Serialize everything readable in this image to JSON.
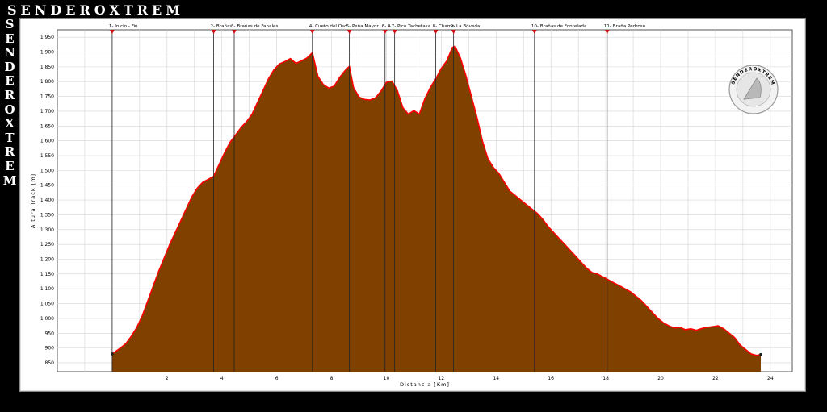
{
  "brand": {
    "name": "SENDEROXTREM",
    "logo_text": "SENDEROXTREM"
  },
  "chart_data": {
    "type": "area",
    "title": "",
    "xlabel": "Distancia [Km]",
    "ylabel": "Altura Track [m]",
    "xlim": [
      -2.0,
      24.8
    ],
    "ylim": [
      820,
      1975
    ],
    "x_ticks": [
      2,
      4,
      6,
      8,
      10,
      12,
      14,
      16,
      18,
      20,
      22,
      24
    ],
    "y_ticks": [
      850,
      900,
      950,
      1000,
      1050,
      1100,
      1150,
      1200,
      1250,
      1300,
      1350,
      1400,
      1450,
      1500,
      1550,
      1600,
      1650,
      1700,
      1750,
      1800,
      1850,
      1900,
      1950
    ],
    "y_tick_labels": [
      "850",
      "900",
      "950",
      "1.000",
      "1.050",
      "1.100",
      "1.150",
      "1.200",
      "1.250",
      "1.300",
      "1.350",
      "1.400",
      "1.450",
      "1.500",
      "1.550",
      "1.600",
      "1.650",
      "1.700",
      "1.750",
      "1.800",
      "1.850",
      "1.900",
      "1.950"
    ],
    "grid": true,
    "fill_color": "#7f4000",
    "line_color": "#ff0000",
    "marker_color": "#d01010",
    "waypoints": [
      {
        "x": 0.0,
        "label": "1- Inicio - Fin"
      },
      {
        "x": 3.7,
        "label": "2- Brañas"
      },
      {
        "x": 4.45,
        "label": "3- Brañas de Fanales"
      },
      {
        "x": 7.3,
        "label": "4- Cueto del Oso"
      },
      {
        "x": 8.65,
        "label": "5- Peña Mayor"
      },
      {
        "x": 9.95,
        "label": "6- A"
      },
      {
        "x": 10.3,
        "label": "7- Pico Tachetasa"
      },
      {
        "x": 11.8,
        "label": "8- Chamo"
      },
      {
        "x": 12.45,
        "label": "9- La Bóveda"
      },
      {
        "x": 15.4,
        "label": "10- Brañas de Fontelada"
      },
      {
        "x": 18.05,
        "label": "11- Braña Pedroso"
      }
    ],
    "series": [
      {
        "x": [
          0.0,
          0.15,
          0.3,
          0.5,
          0.7,
          0.9,
          1.1,
          1.3,
          1.5,
          1.7,
          1.9,
          2.1,
          2.3,
          2.5,
          2.7,
          2.9,
          3.1,
          3.3,
          3.5,
          3.7,
          3.9,
          4.1,
          4.3,
          4.5,
          4.7,
          4.9,
          5.1,
          5.3,
          5.5,
          5.7,
          5.9,
          6.1,
          6.3,
          6.5,
          6.7,
          6.9,
          7.1,
          7.3,
          7.5,
          7.7,
          7.9,
          8.1,
          8.3,
          8.5,
          8.65,
          8.8,
          9.0,
          9.2,
          9.4,
          9.6,
          9.8,
          10.0,
          10.2,
          10.4,
          10.6,
          10.8,
          11.0,
          11.2,
          11.4,
          11.6,
          11.8,
          12.0,
          12.2,
          12.4,
          12.5,
          12.7,
          12.9,
          13.1,
          13.3,
          13.5,
          13.7,
          13.9,
          14.1,
          14.3,
          14.5,
          14.7,
          14.9,
          15.1,
          15.3,
          15.5,
          15.7,
          15.9,
          16.1,
          16.3,
          16.5,
          16.7,
          16.9,
          17.1,
          17.3,
          17.5,
          17.7,
          17.9,
          18.1,
          18.3,
          18.5,
          18.7,
          18.9,
          19.1,
          19.3,
          19.5,
          19.7,
          19.9,
          20.1,
          20.3,
          20.5,
          20.7,
          20.9,
          21.1,
          21.3,
          21.5,
          21.7,
          21.9,
          22.1,
          22.3,
          22.5,
          22.7,
          22.9,
          23.1,
          23.3,
          23.5,
          23.65
        ],
        "values": [
          880,
          890,
          900,
          915,
          940,
          970,
          1010,
          1060,
          1110,
          1160,
          1205,
          1250,
          1290,
          1330,
          1370,
          1410,
          1440,
          1460,
          1470,
          1480,
          1520,
          1560,
          1595,
          1620,
          1645,
          1665,
          1690,
          1730,
          1770,
          1810,
          1840,
          1860,
          1868,
          1878,
          1862,
          1870,
          1880,
          1898,
          1818,
          1790,
          1778,
          1785,
          1815,
          1838,
          1852,
          1780,
          1748,
          1740,
          1738,
          1745,
          1768,
          1798,
          1802,
          1770,
          1712,
          1690,
          1702,
          1690,
          1742,
          1780,
          1810,
          1845,
          1870,
          1915,
          1920,
          1880,
          1820,
          1750,
          1680,
          1600,
          1540,
          1510,
          1490,
          1460,
          1430,
          1415,
          1400,
          1385,
          1370,
          1355,
          1335,
          1310,
          1290,
          1270,
          1250,
          1230,
          1210,
          1190,
          1170,
          1155,
          1150,
          1140,
          1130,
          1120,
          1110,
          1100,
          1090,
          1075,
          1060,
          1040,
          1020,
          1000,
          985,
          975,
          968,
          970,
          962,
          965,
          960,
          966,
          970,
          972,
          975,
          965,
          950,
          935,
          910,
          895,
          880,
          875,
          878
        ]
      }
    ]
  }
}
